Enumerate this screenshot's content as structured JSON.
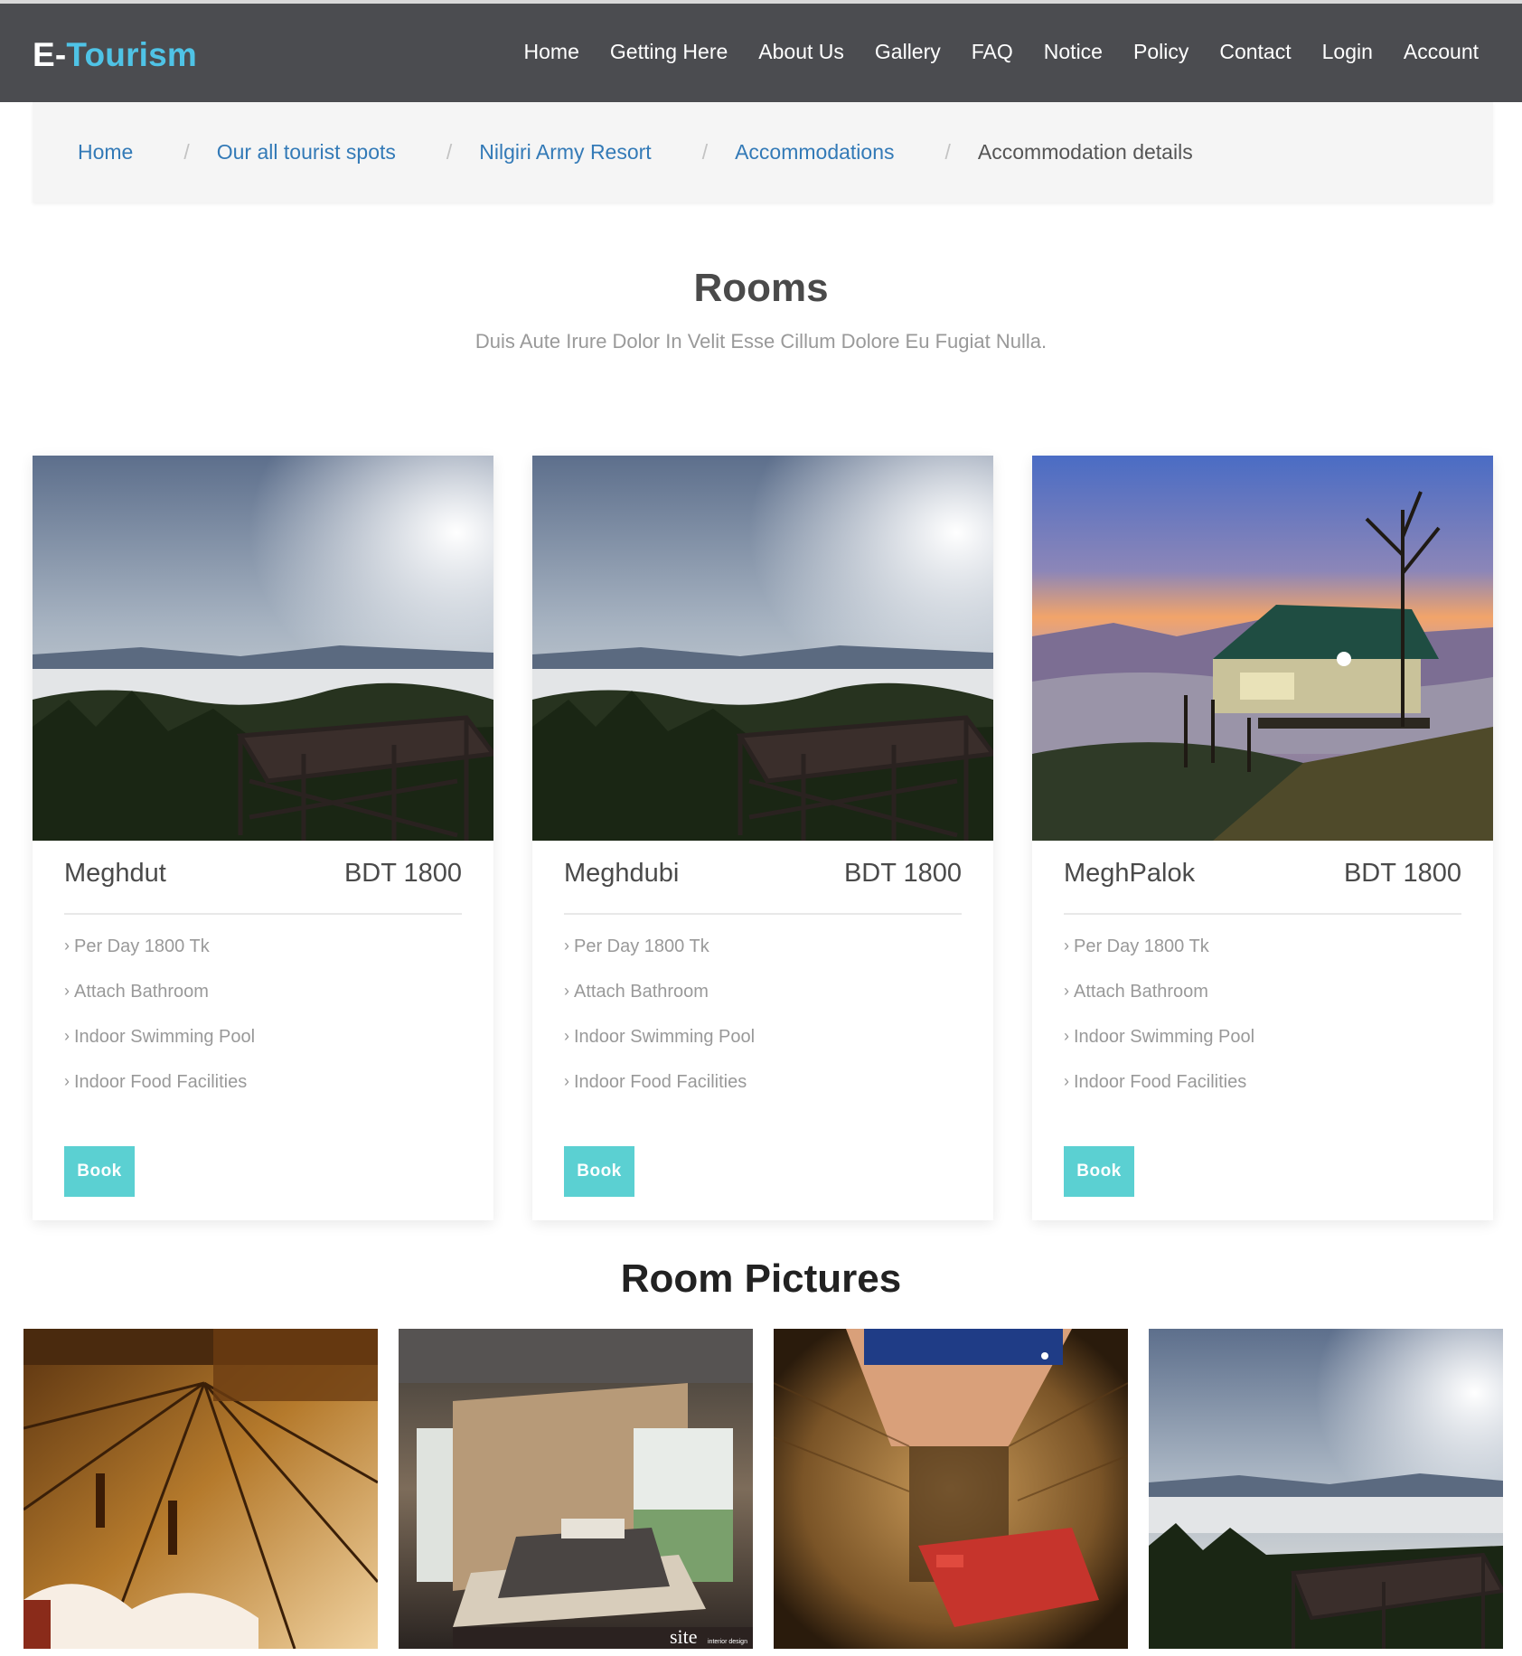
{
  "brand": {
    "part1": "E-",
    "part2": "Tourism"
  },
  "nav": [
    "Home",
    "Getting Here",
    "About Us",
    "Gallery",
    "FAQ",
    "Notice",
    "Policy",
    "Contact",
    "Login",
    "Account"
  ],
  "breadcrumb": [
    "Home",
    "Our all tourist spots",
    "Nilgiri Army Resort",
    "Accommodations",
    "Accommodation details"
  ],
  "rooms_section": {
    "title": "Rooms",
    "subtitle": "Duis Aute Irure Dolor In Velit Esse Cillum Dolore Eu Fugiat Nulla."
  },
  "rooms": [
    {
      "name": "Meghdut",
      "price": "BDT 1800",
      "features": [
        "Per Day 1800 Tk",
        "Attach Bathroom",
        "Indoor Swimming Pool",
        "Indoor Food Facilities"
      ],
      "button": "Book",
      "image": "cloud-valley-deck"
    },
    {
      "name": "Meghdubi",
      "price": "BDT 1800",
      "features": [
        "Per Day 1800 Tk",
        "Attach Bathroom",
        "Indoor Swimming Pool",
        "Indoor Food Facilities"
      ],
      "button": "Book",
      "image": "cloud-valley-deck"
    },
    {
      "name": "MeghPalok",
      "price": "BDT 1800",
      "features": [
        "Per Day 1800 Tk",
        "Attach Bathroom",
        "Indoor Swimming Pool",
        "Indoor Food Facilities"
      ],
      "button": "Book",
      "image": "hill-cottage-sunset"
    }
  ],
  "pictures": {
    "title": "Room Pictures",
    "items": [
      "wooden-ceiling",
      "modern-bedroom",
      "bamboo-cabin-room",
      "cloud-valley-deck"
    ],
    "watermark": "site",
    "watermark_sub": "interior design"
  },
  "colors": {
    "navbar": "#4b4c50",
    "brand_accent": "#4fc3e6",
    "link": "#337ab7",
    "button": "#5bd0d2"
  }
}
